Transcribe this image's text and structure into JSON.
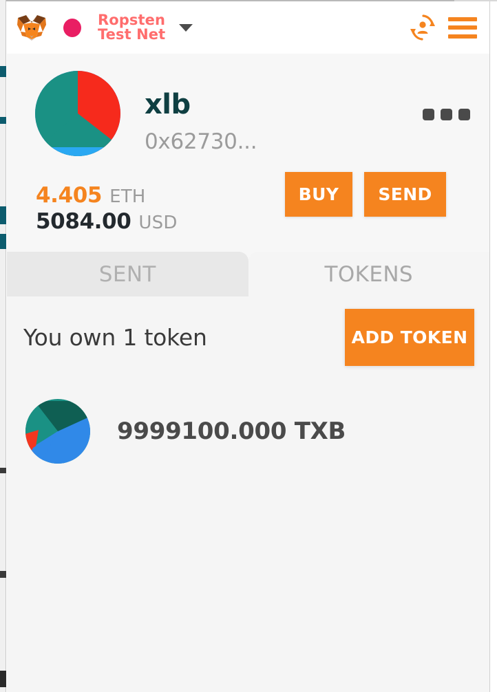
{
  "header": {
    "logo_icon": "metamask-fox-logo",
    "network_status_icon": "network-status-dot",
    "network_status_color": "#e91e63",
    "network_name": "Ropsten\nTest Net",
    "network_caret_icon": "chevron-down-icon",
    "account_switch_icon": "account-switch-icon",
    "menu_icon": "hamburger-menu-icon",
    "accent_color": "#f5841f",
    "network_text_color": "#ff6d6d"
  },
  "account": {
    "identicon_icon": "account-identicon",
    "name": "xlb",
    "address": "0x62730...",
    "options_icon": "more-options-icon",
    "balance": {
      "eth_amount": "4.405",
      "eth_unit": "ETH",
      "usd_amount": "5084.00",
      "usd_unit": "USD",
      "eth_color": "#f5841f"
    },
    "actions": {
      "buy_label": "BUY",
      "send_label": "SEND"
    }
  },
  "tabs": [
    {
      "label": "SENT",
      "active": false
    },
    {
      "label": "TOKENS",
      "active": true
    }
  ],
  "tokens": {
    "count_label": "You own 1 token",
    "add_button_label": "ADD TOKEN",
    "items": [
      {
        "identicon_icon": "token-identicon",
        "amount_label": "9999100.000 TXB"
      }
    ]
  }
}
